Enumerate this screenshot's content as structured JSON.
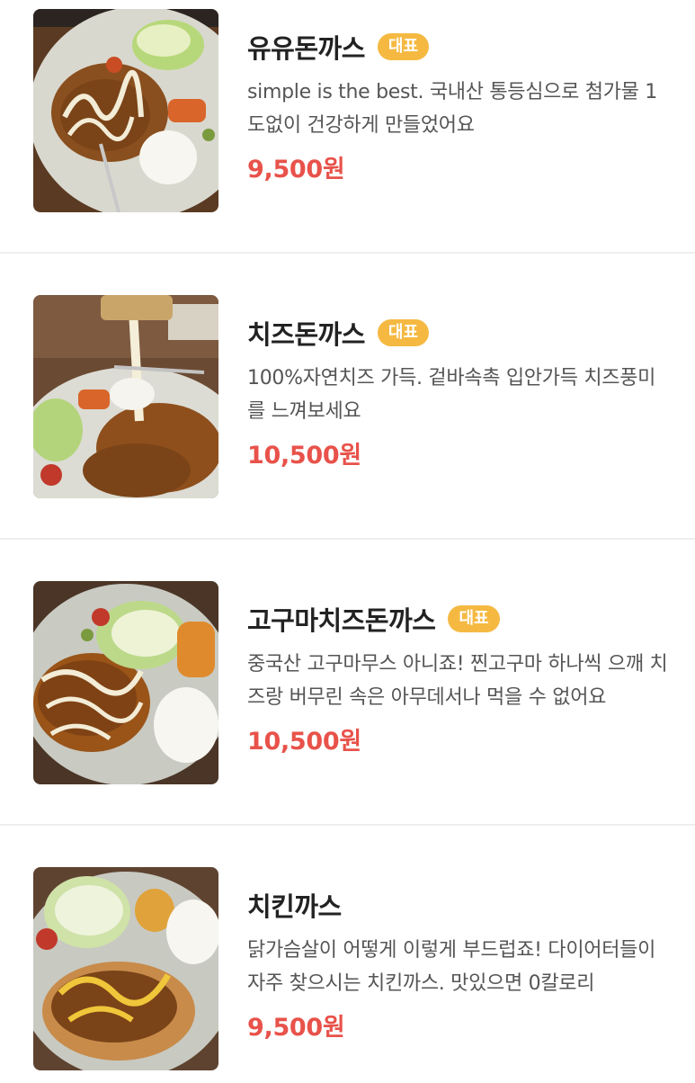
{
  "menu": {
    "items": [
      {
        "name": "유유돈까스",
        "badge": "대표",
        "description": "simple is the best. 국내산 통등심으로 첨가물 1도없이 건강하게 만들었어요",
        "price": "9,500원",
        "image": "pork-cutlet-photo"
      },
      {
        "name": "치즈돈까스",
        "badge": "대표",
        "description": "100%자연치즈 가득. 겉바속촉 입안가득 치즈풍미를 느껴보세요",
        "price": "10,500원",
        "image": "cheese-cutlet-photo"
      },
      {
        "name": "고구마치즈돈까스",
        "badge": "대표",
        "description": "중국산 고구마무스 아니죠! 찐고구마 하나씩 으깨 치즈랑 버무린 속은 아무데서나 먹을 수 없어요",
        "price": "10,500원",
        "image": "sweet-potato-cheese-cutlet-photo"
      },
      {
        "name": "치킨까스",
        "badge": "",
        "description": "닭가슴살이 어떻게 이렇게 부드럽죠! 다이어터들이 자주 찾으시는 치킨까스. 맛있으면 0칼로리",
        "price": "9,500원",
        "image": "chicken-cutlet-photo"
      }
    ]
  },
  "colors": {
    "badge": "#f5b942",
    "price": "#e8524a",
    "title": "#222222",
    "description": "#555555",
    "divider": "#eeeeee"
  }
}
